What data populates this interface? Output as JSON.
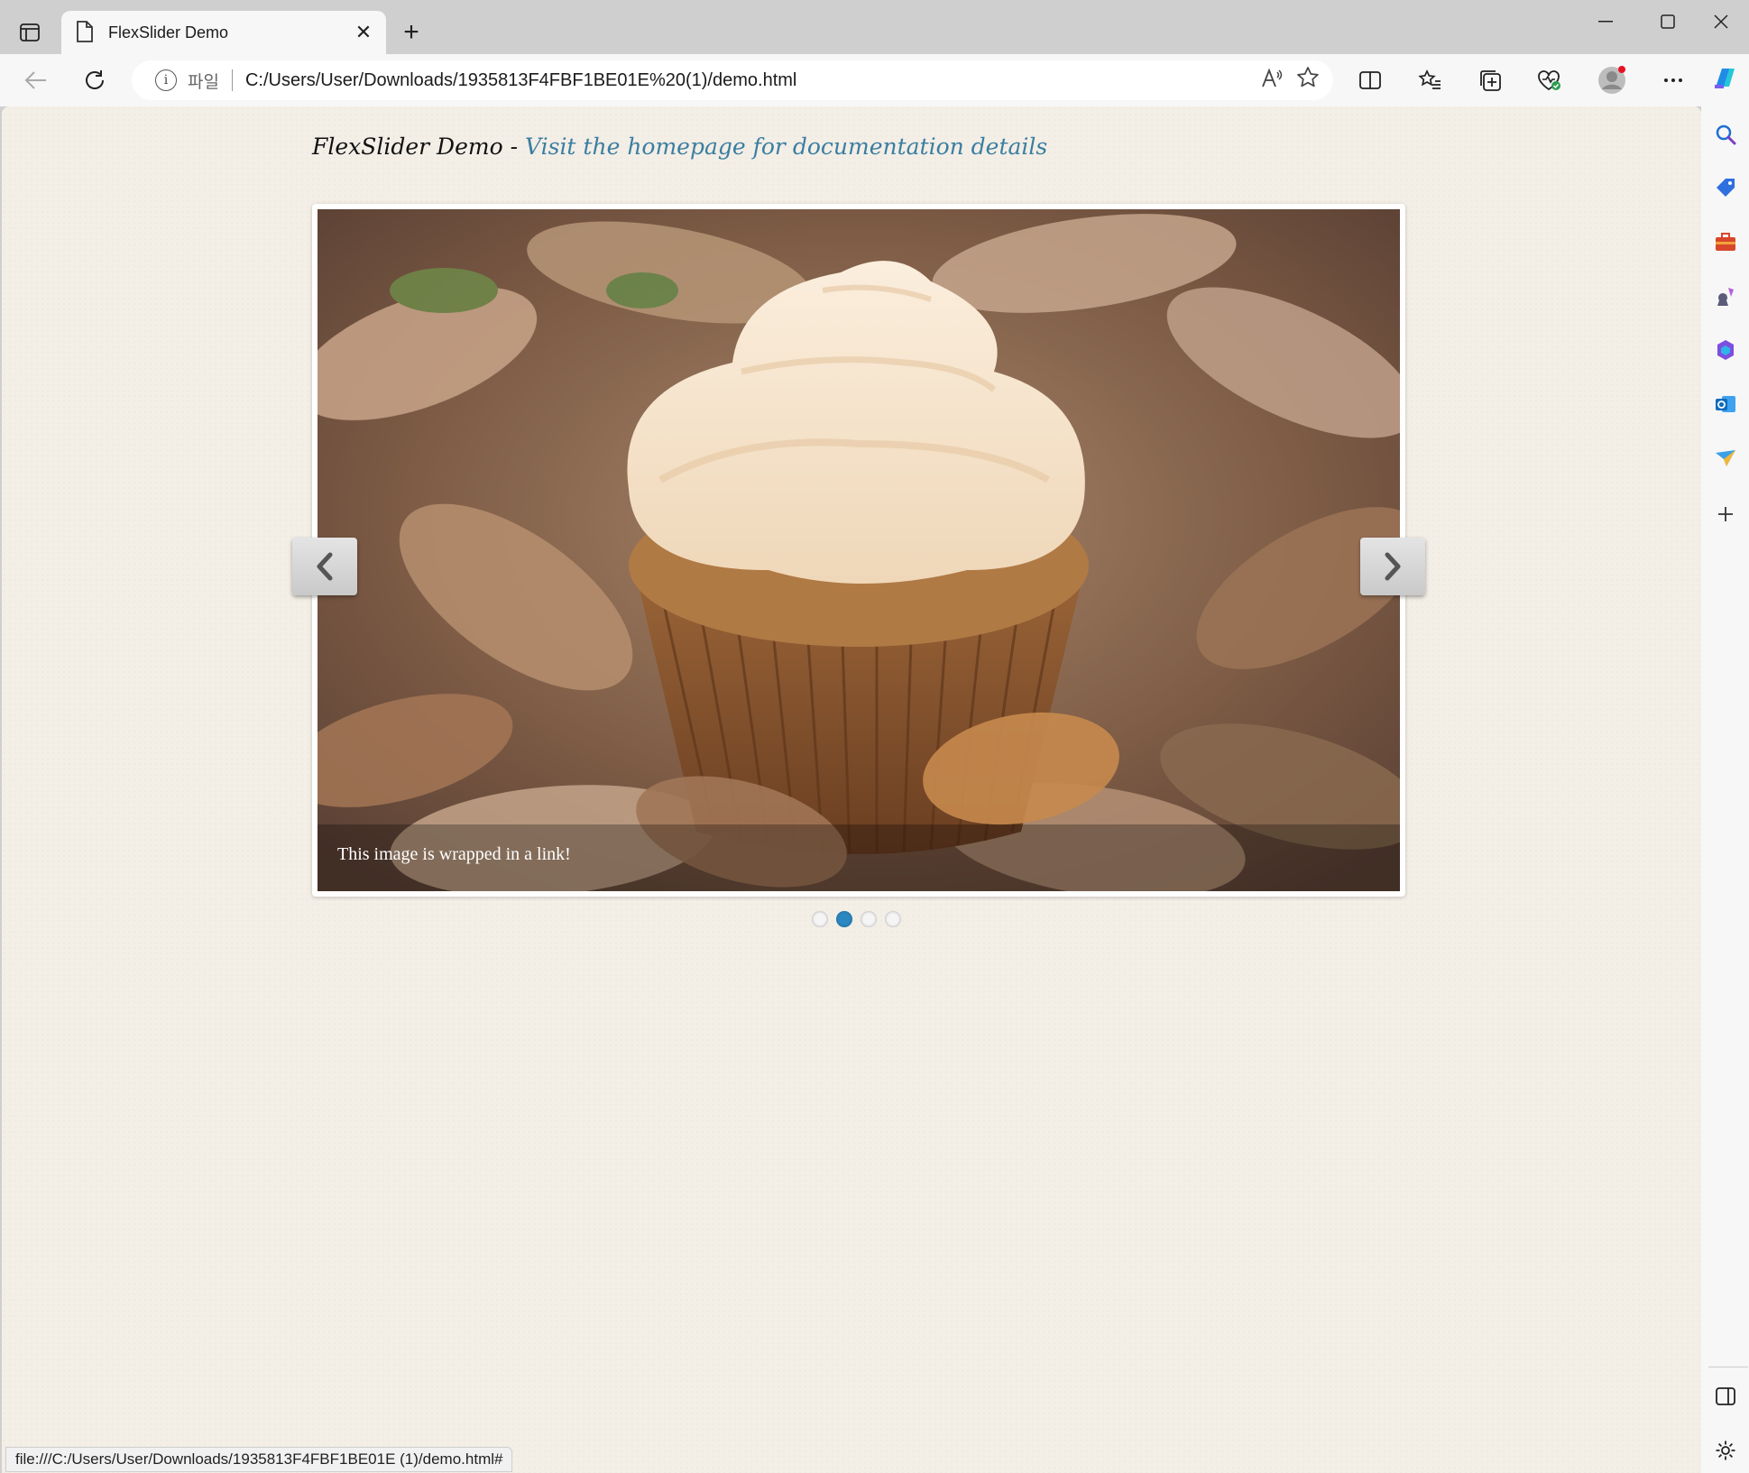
{
  "browser": {
    "tab_title": "FlexSlider Demo",
    "tab_close": "✕",
    "new_tab": "+",
    "address": {
      "scheme_label": "파일",
      "url": "C:/Users/User/Downloads/1935813F4FBF1BE01E%20(1)/demo.html",
      "read_aloud": "A))"
    },
    "status_url": "file:///C:/Users/User/Downloads/1935813F4FBF1BE01E (1)/demo.html#"
  },
  "page": {
    "heading_prefix": "FlexSlider Demo - ",
    "heading_link": "Visit the homepage for documentation details",
    "slider": {
      "caption": "This image is wrapped in a link!",
      "slide_count": 4,
      "active_index": 1
    }
  },
  "icons": {
    "sidebar": [
      "search-icon",
      "shopping-tag-icon",
      "toolbox-icon",
      "games-icon",
      "office-icon",
      "outlook-icon",
      "send-icon",
      "add-icon"
    ],
    "colors": {
      "active_dot": "#2b87c1",
      "link": "#3a7ea1",
      "page_bg": "#f3eee6"
    }
  }
}
